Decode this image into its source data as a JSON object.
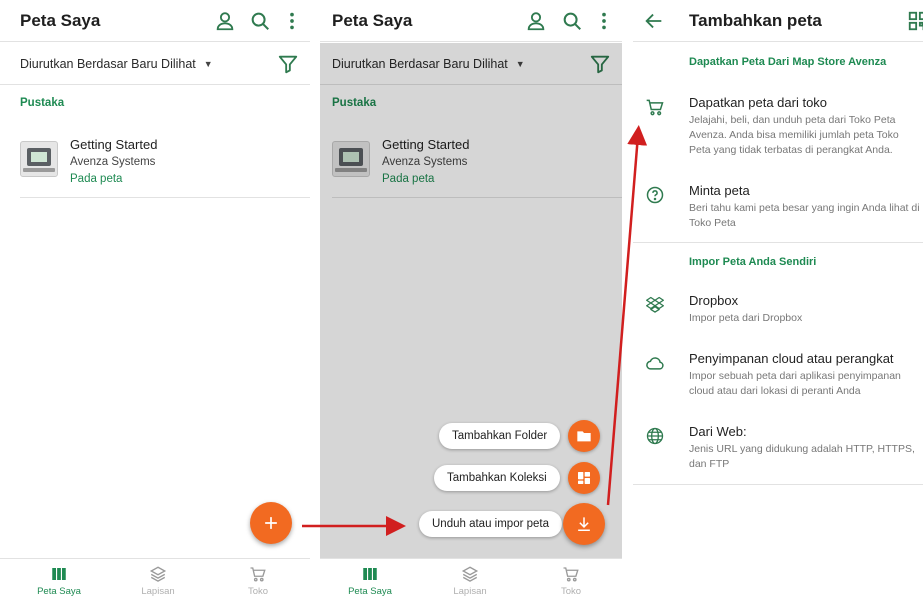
{
  "panel1": {
    "title": "Peta Saya",
    "sort_label": "Diurutkan Berdasar Baru Dilihat",
    "section": "Pustaka",
    "map": {
      "title": "Getting Started",
      "publisher": "Avenza Systems",
      "status": "Pada peta"
    },
    "nav": [
      "Peta Saya",
      "Lapisan",
      "Toko"
    ]
  },
  "panel2": {
    "title": "Peta Saya",
    "sort_label": "Diurutkan Berdasar Baru Dilihat",
    "section": "Pustaka",
    "map": {
      "title": "Getting Started",
      "publisher": "Avenza Systems",
      "status": "Pada peta"
    },
    "actions": {
      "add_folder": "Tambahkan Folder",
      "add_collection": "Tambahkan Koleksi",
      "download_import": "Unduh atau impor peta"
    },
    "nav": [
      "Peta Saya",
      "Lapisan",
      "Toko"
    ]
  },
  "panel3": {
    "title": "Tambahkan peta",
    "section_store": "Dapatkan Peta Dari Map Store Avenza",
    "options_store": [
      {
        "title": "Dapatkan peta dari toko",
        "desc": "Jelajahi, beli, dan unduh peta dari Toko Peta Avenza. Anda bisa memiliki jumlah peta Toko Peta yang tidak terbatas di perangkat Anda.",
        "icon": "cart-icon"
      },
      {
        "title": "Minta peta",
        "desc": "Beri tahu kami peta besar yang ingin Anda lihat di Toko Peta",
        "icon": "question-icon"
      }
    ],
    "section_import": "Impor Peta Anda Sendiri",
    "options_import": [
      {
        "title": "Dropbox",
        "desc": "Impor peta dari Dropbox",
        "icon": "dropbox-icon"
      },
      {
        "title": "Penyimpanan cloud atau perangkat",
        "desc": "Impor sebuah peta dari aplikasi penyimpanan cloud atau dari lokasi di peranti Anda",
        "icon": "cloud-icon"
      },
      {
        "title": "Dari Web:",
        "desc": "Jenis URL yang didukung adalah HTTP, HTTPS, dan FTP",
        "icon": "globe-icon"
      }
    ]
  },
  "colors": {
    "accent": "#f26a21",
    "green": "#1e8a52",
    "arrow": "#d11f1f"
  }
}
